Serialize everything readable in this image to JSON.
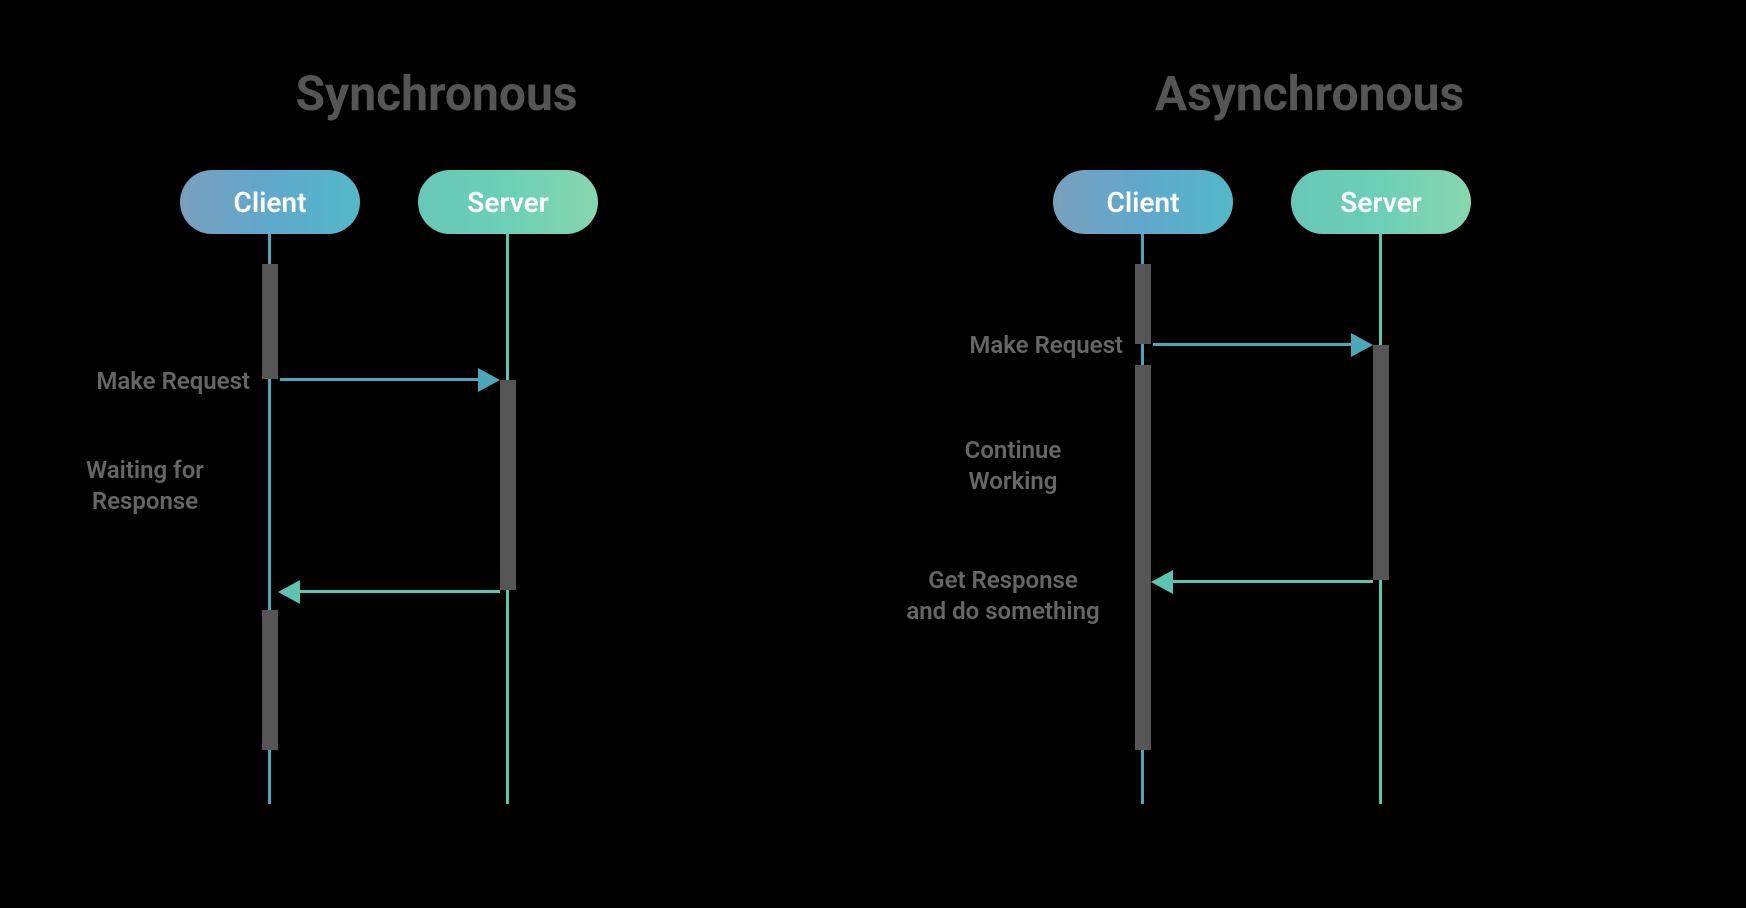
{
  "sync": {
    "title": "Synchronous",
    "client_label": "Client",
    "server_label": "Server",
    "make_request": "Make Request",
    "waiting_line1": "Waiting for",
    "waiting_line2": "Response"
  },
  "async": {
    "title": "Asynchronous",
    "client_label": "Client",
    "server_label": "Server",
    "make_request": "Make Request",
    "continue_line1": "Continue",
    "continue_line2": "Working",
    "getresp_line1": "Get Response",
    "getresp_line2": "and do something"
  },
  "colors": {
    "client_gradient_start": "#7a9fbe",
    "client_gradient_end": "#53b8c8",
    "server_gradient_start": "#68c8b8",
    "server_gradient_end": "#88d6b0",
    "lifeline_client": "#4da7b8",
    "lifeline_server": "#5bc5b0",
    "activation_bar": "#555555",
    "label_text": "#666666",
    "title_text": "#555555"
  }
}
